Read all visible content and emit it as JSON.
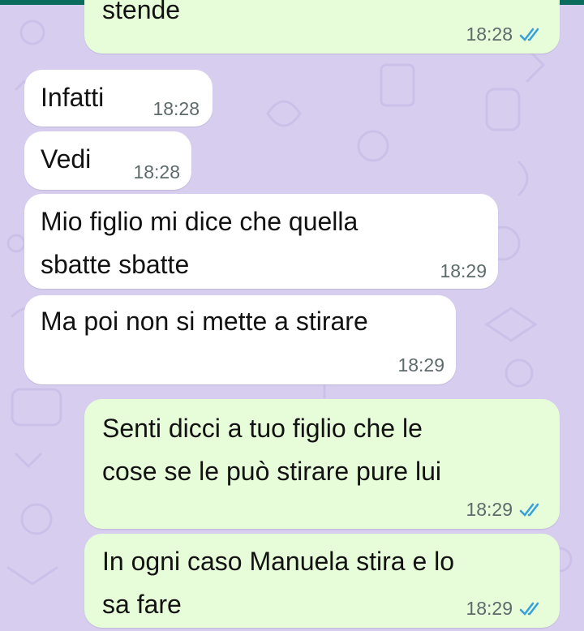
{
  "colors": {
    "wallpaper": "#d6cdef",
    "incoming_bubble": "#ffffff",
    "outgoing_bubble": "#e7fcd9",
    "read_tick": "#34a0e0"
  },
  "messages": [
    {
      "direction": "outgoing",
      "text": "stende",
      "time": "18:28",
      "status": "read"
    },
    {
      "direction": "incoming",
      "text": "Infatti",
      "time": "18:28"
    },
    {
      "direction": "incoming",
      "text": "Vedi",
      "time": "18:28"
    },
    {
      "direction": "incoming",
      "text": "Mio figlio mi dice che quella\nsbatte sbatte",
      "time": "18:29"
    },
    {
      "direction": "incoming",
      "text": "Ma poi non si mette a stirare",
      "time": "18:29"
    },
    {
      "direction": "outgoing",
      "text": "Senti dicci a tuo figlio che le\ncose se le può stirare pure lui",
      "time": "18:29",
      "status": "read"
    },
    {
      "direction": "outgoing",
      "text": "In ogni caso Manuela stira e lo\nsa fare",
      "time": "18:29",
      "status": "read"
    }
  ]
}
